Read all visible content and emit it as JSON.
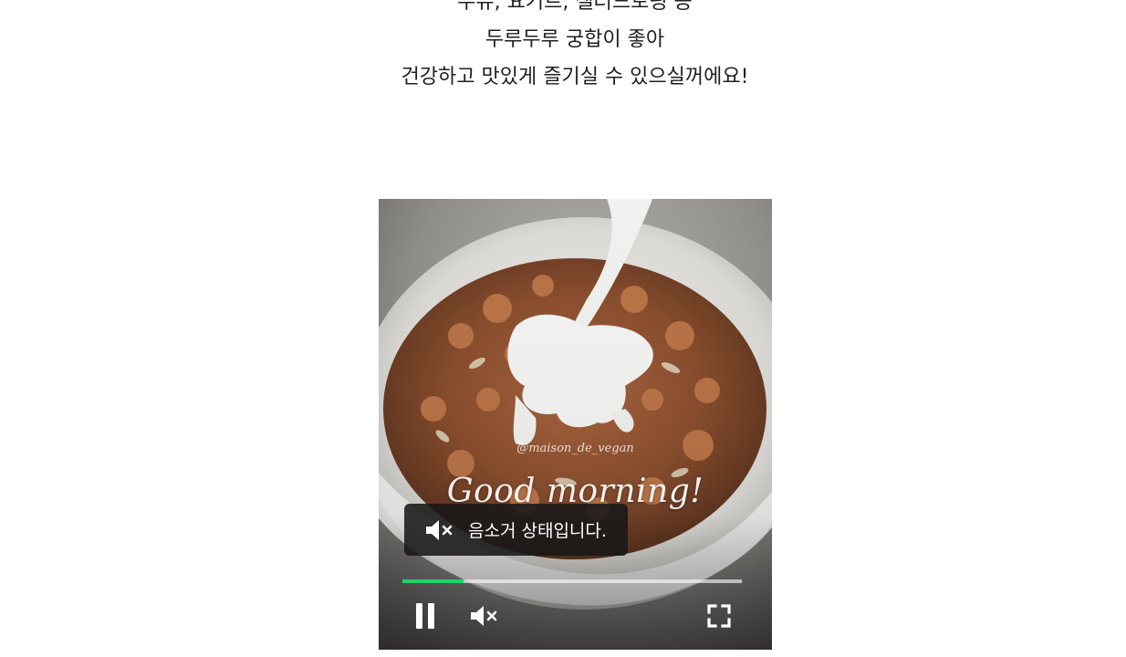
{
  "article": {
    "lines": [
      "두유, 요거트, 샐러드토핑 등",
      "두루두루 궁합이 좋아",
      "건강하고 맛있게 즐기실 수 있으실꺼에요!"
    ]
  },
  "video": {
    "watermark": "@maison_de_vegan",
    "caption": "Good morning!",
    "toast": {
      "text": "음소거 상태입니다.",
      "icon": "muted-speaker-icon"
    },
    "progress": {
      "fraction": 0.18,
      "color": "#1ed46a"
    },
    "controls": {
      "play_pause_icon": "pause-icon",
      "mute_icon": "muted-speaker-icon",
      "fullscreen_icon": "fullscreen-icon"
    }
  }
}
